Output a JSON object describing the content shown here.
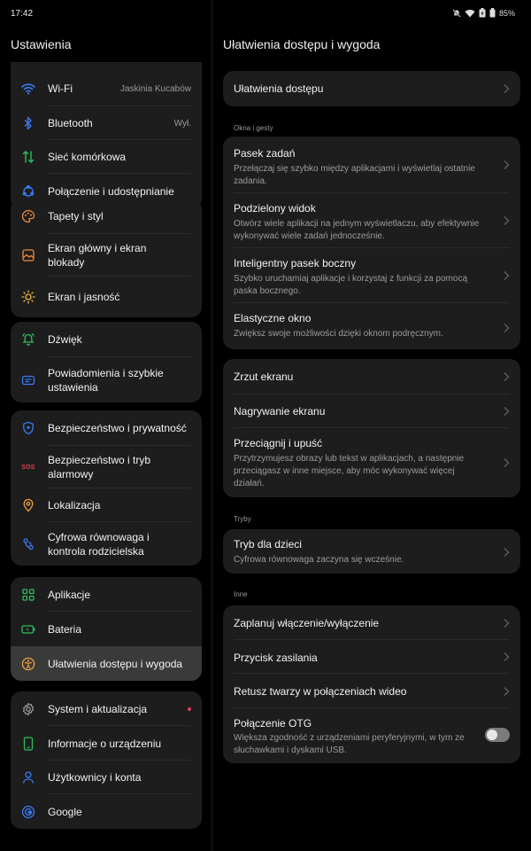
{
  "status_bar": {
    "time": "17:42",
    "battery": "85%"
  },
  "left_panel": {
    "title": "Ustawienia",
    "groups": [
      {
        "items": [
          {
            "label": "Wi-Fi",
            "value": "Jaskinia Kucabów",
            "icon": "wifi-icon"
          },
          {
            "label": "Bluetooth",
            "value": "Wył.",
            "icon": "bluetooth-icon"
          },
          {
            "label": "Sieć komórkowa",
            "icon": "cellular-icon"
          },
          {
            "label": "Połączenie i udostępnianie",
            "icon": "connection-sharing-icon"
          }
        ]
      },
      {
        "items": [
          {
            "label": "Tapety i styl",
            "icon": "palette-icon"
          },
          {
            "label": "Ekran główny i ekran blokady",
            "icon": "home-screen-icon"
          },
          {
            "label": "Ekran i jasność",
            "icon": "brightness-icon"
          }
        ]
      },
      {
        "items": [
          {
            "label": "Dźwięk",
            "icon": "bell-icon"
          },
          {
            "label": "Powiadomienia i szybkie ustawienia",
            "icon": "notifications-icon"
          }
        ]
      },
      {
        "items": [
          {
            "label": "Bezpieczeństwo i prywatność",
            "icon": "shield-icon"
          },
          {
            "label": "Bezpieczeństwo i tryb alarmowy",
            "icon": "sos-icon",
            "icon_text": "SOS"
          },
          {
            "label": "Lokalizacja",
            "icon": "location-icon"
          },
          {
            "label": "Cyfrowa równowaga i kontrola rodzicielska",
            "icon": "digital-wellbeing-icon"
          }
        ]
      },
      {
        "items": [
          {
            "label": "Aplikacje",
            "icon": "apps-icon"
          },
          {
            "label": "Bateria",
            "icon": "battery-icon"
          },
          {
            "label": "Ułatwienia dostępu i wygoda",
            "icon": "accessibility-icon",
            "selected": true
          }
        ]
      },
      {
        "items": [
          {
            "label": "System i aktualizacja",
            "icon": "gear-icon",
            "badge": true
          },
          {
            "label": "Informacje o urządzeniu",
            "icon": "phone-icon"
          },
          {
            "label": "Użytkownicy i konta",
            "icon": "user-icon"
          },
          {
            "label": "Google",
            "icon": "google-icon"
          }
        ]
      }
    ]
  },
  "right_panel": {
    "title": "Ułatwienia dostępu i wygoda",
    "accessibility": "Ułatwienia dostępu",
    "section_windows": "Okna i gesty",
    "windows": [
      {
        "title": "Pasek zadań",
        "desc": "Przełączaj się szybko między aplikacjami i wyświetlaj ostatnie zadania."
      },
      {
        "title": "Podzielony widok",
        "desc": "Otwórz wiele aplikacji na jednym wyświetlaczu, aby efektywnie wykonywać wiele zadań jednocześnie."
      },
      {
        "title": "Inteligentny pasek boczny",
        "desc": "Szybko uruchamiaj aplikacje i korzystaj z funkcji za pomocą paska bocznego."
      },
      {
        "title": "Elastyczne okno",
        "desc": "Zwiększ swoje możliwości dzięki oknom podręcznym."
      }
    ],
    "screen": [
      {
        "title": "Zrzut ekranu"
      },
      {
        "title": "Nagrywanie ekranu"
      },
      {
        "title": "Przeciągnij i upuść",
        "desc": "Przytrzymujesz obrazy lub tekst w aplikacjach, a następnie przeciągasz w inne miejsce, aby móc wykonywać więcej działań."
      }
    ],
    "section_modes": "Tryby",
    "kids_mode": {
      "title": "Tryb dla dzieci",
      "desc": "Cyfrowa równowaga zaczyna się wcześnie."
    },
    "section_other": "Inne",
    "other": [
      {
        "title": "Zaplanuj włączenie/wyłączenie"
      },
      {
        "title": "Przycisk zasilania"
      },
      {
        "title": "Retusz twarzy w połączeniach wideo"
      }
    ],
    "otg": {
      "title": "Połączenie OTG",
      "desc": "Większa zgodność z urządzeniami peryferyjnymi, w tym ze słuchawkami i dyskami USB.",
      "enabled": false
    }
  }
}
